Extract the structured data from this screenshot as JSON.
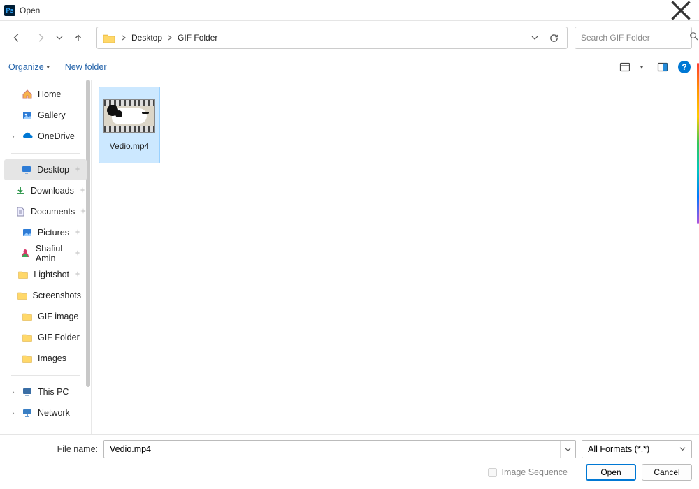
{
  "window": {
    "title": "Open"
  },
  "nav": {
    "breadcrumbs": [
      "Desktop",
      "GIF Folder"
    ],
    "search_placeholder": "Search GIF Folder"
  },
  "toolbar": {
    "organize": "Organize",
    "newfolder": "New folder"
  },
  "sidebar": {
    "items": [
      {
        "kind": "item",
        "label": "Home",
        "icon": "home",
        "expand": ""
      },
      {
        "kind": "item",
        "label": "Gallery",
        "icon": "gallery",
        "expand": ""
      },
      {
        "kind": "item",
        "label": "OneDrive",
        "icon": "onedrive",
        "expand": "›"
      },
      {
        "kind": "sep"
      },
      {
        "kind": "item",
        "label": "Desktop",
        "icon": "desktop",
        "expand": "",
        "selected": true,
        "pin": true
      },
      {
        "kind": "item",
        "label": "Downloads",
        "icon": "downloads",
        "expand": "",
        "pin": true
      },
      {
        "kind": "item",
        "label": "Documents",
        "icon": "documents",
        "expand": "",
        "pin": true
      },
      {
        "kind": "item",
        "label": "Pictures",
        "icon": "pictures",
        "expand": "",
        "pin": true
      },
      {
        "kind": "item",
        "label": "Shafiul Amin",
        "icon": "user",
        "expand": "",
        "pin": true
      },
      {
        "kind": "item",
        "label": "Lightshot",
        "icon": "folder",
        "expand": "",
        "pin": true
      },
      {
        "kind": "item",
        "label": "Screenshots",
        "icon": "folder",
        "expand": ""
      },
      {
        "kind": "item",
        "label": "GIF image",
        "icon": "folder",
        "expand": ""
      },
      {
        "kind": "item",
        "label": "GIF Folder",
        "icon": "folder",
        "expand": ""
      },
      {
        "kind": "item",
        "label": "Images",
        "icon": "folder",
        "expand": ""
      },
      {
        "kind": "sep"
      },
      {
        "kind": "item",
        "label": "This PC",
        "icon": "pc",
        "expand": "›"
      },
      {
        "kind": "item",
        "label": "Network",
        "icon": "network",
        "expand": "›"
      }
    ]
  },
  "files": [
    {
      "name": "Vedio.mp4",
      "selected": true
    }
  ],
  "bottom": {
    "filename_label": "File name:",
    "filename_value": "Vedio.mp4",
    "filter": "All Formats (*.*)",
    "image_sequence": "Image Sequence",
    "open": "Open",
    "cancel": "Cancel"
  }
}
